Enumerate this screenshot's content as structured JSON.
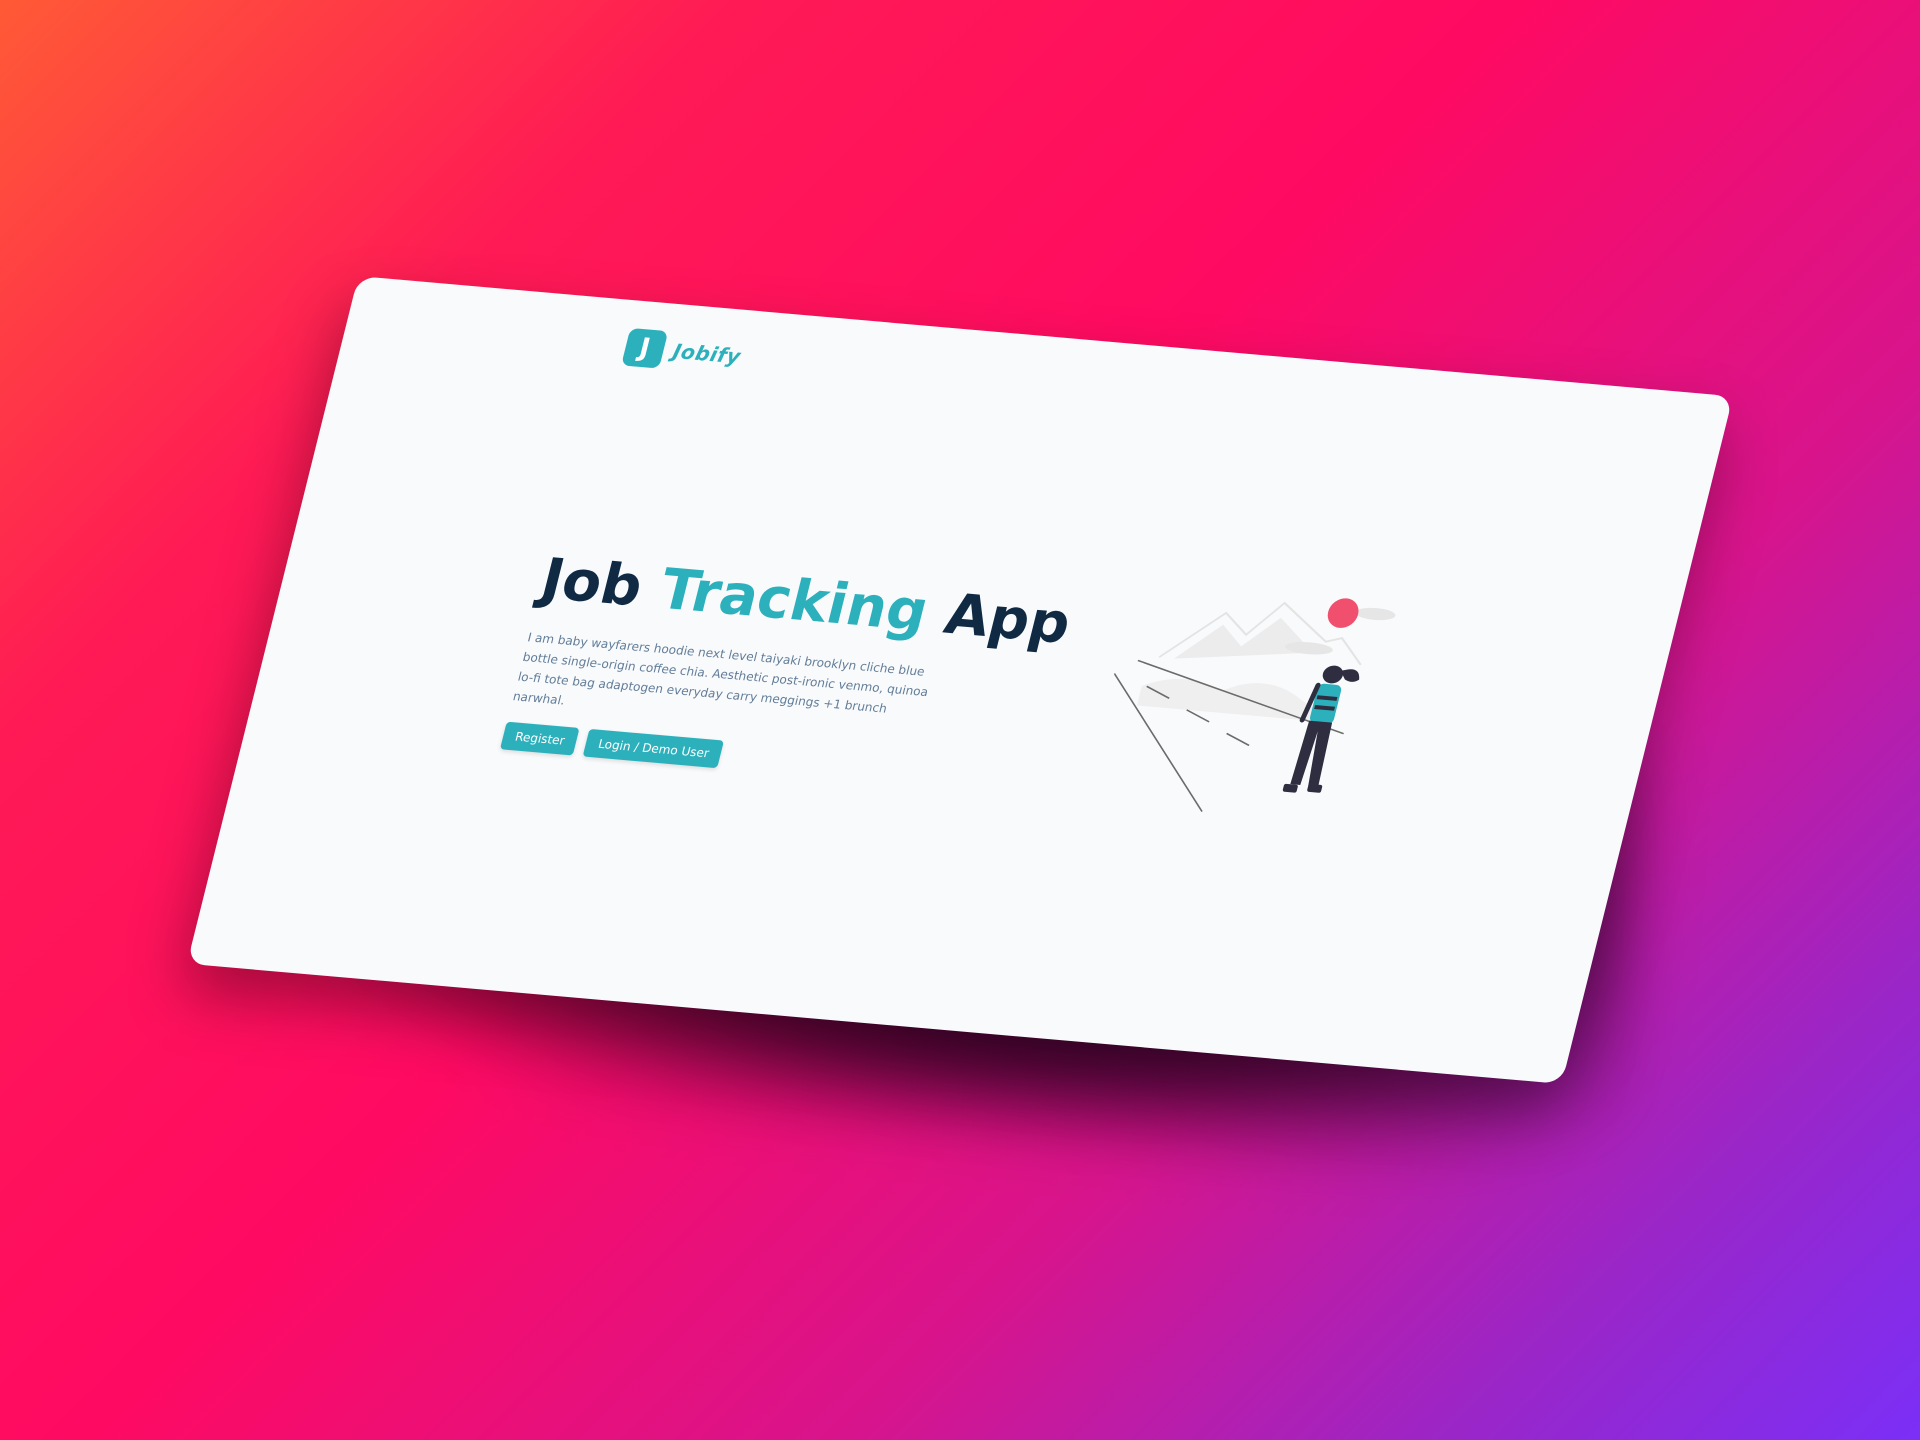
{
  "brand": {
    "logo_letter": "J",
    "name": "Jobify",
    "accent_color": "#2cb1bc"
  },
  "hero": {
    "title_part1": "Job",
    "title_accent": "Tracking",
    "title_part2": "App",
    "description": "I am baby wayfarers hoodie next level taiyaki brooklyn cliche blue bottle single-origin coffee chia. Aesthetic post-ironic venmo, quinoa lo-fi tote bag adaptogen everyday carry meggings +1 brunch narwhal.",
    "buttons": {
      "register": "Register",
      "login": "Login / Demo User"
    }
  },
  "illustration": {
    "icon": "woman-on-road-illustration",
    "sun_color": "#f0506e",
    "figure_color": "#2f2e41"
  },
  "background": {
    "gradient_start": "#ff5a36",
    "gradient_mid": "#ff0a62",
    "gradient_end": "#7b2ff7"
  }
}
